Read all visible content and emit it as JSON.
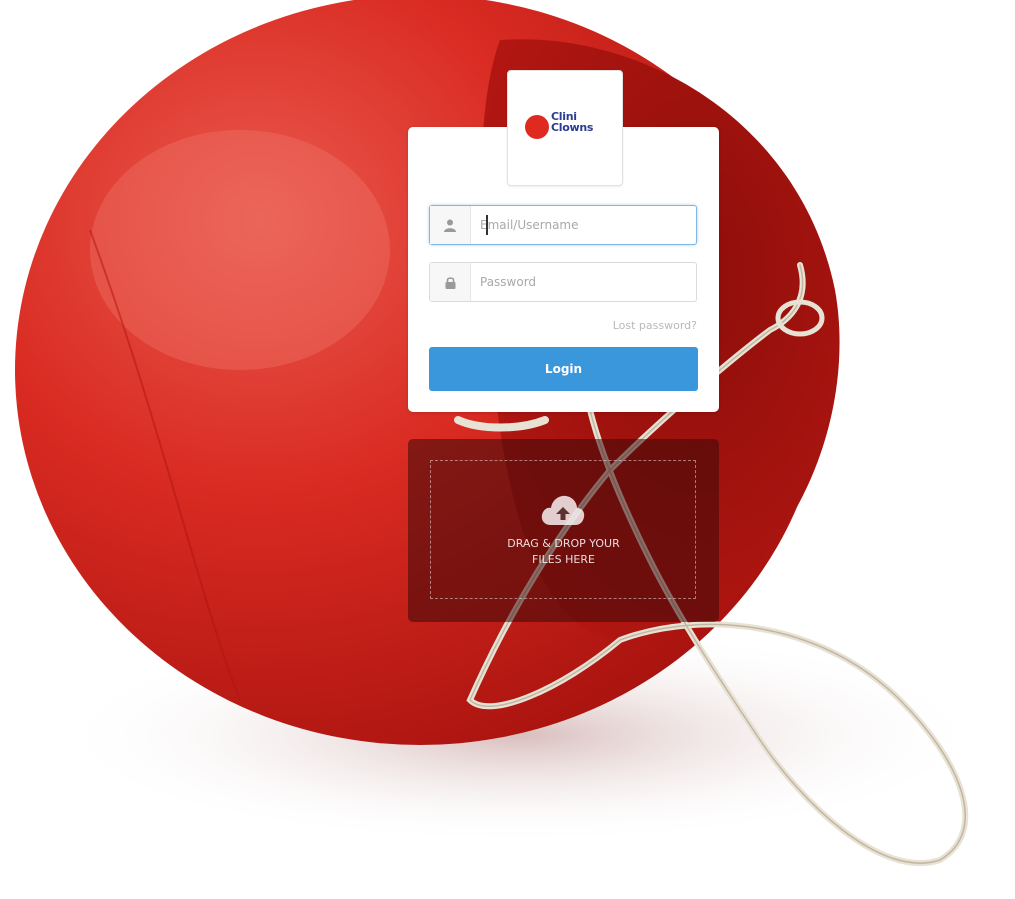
{
  "brand": {
    "logo_text": "Clini\nClowns",
    "logo_color": "#2a3d8f",
    "logo_dot_color": "#e02a1f"
  },
  "login": {
    "username_placeholder": "Email/Username",
    "username_icon": "user-icon",
    "password_placeholder": "Password",
    "password_icon": "lock-icon",
    "lost_password_label": "Lost password?",
    "login_label": "Login",
    "accent_color": "#3a97dc"
  },
  "dropzone": {
    "text": "DRAG & DROP YOUR\nFILES HERE",
    "icon": "cloud-upload-icon"
  }
}
